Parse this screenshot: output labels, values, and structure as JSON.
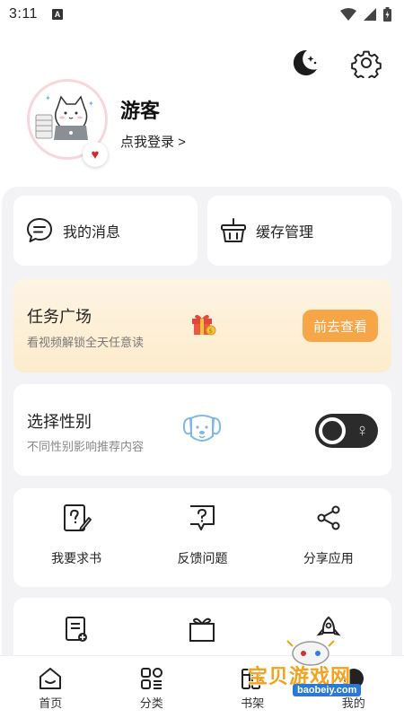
{
  "status_bar": {
    "time": "3:11",
    "badge": "A"
  },
  "header": {
    "theme_icon": "moon-stars-icon",
    "settings_icon": "gear-icon"
  },
  "profile": {
    "username": "游客",
    "login_link": "点我登录 >",
    "heart_icon": "heart-icon"
  },
  "quick_actions": {
    "messages_label": "我的消息",
    "cache_label": "缓存管理"
  },
  "task": {
    "title": "任务广场",
    "subtitle": "看视频解锁全天任意读",
    "button": "前去查看",
    "accent": "#f6a647"
  },
  "gender": {
    "title": "选择性别",
    "subtitle": "不同性别影响推荐内容",
    "toggle_symbol": "♀"
  },
  "tools": [
    {
      "label": "我要求书",
      "icon": "edit-document-icon"
    },
    {
      "label": "反馈问题",
      "icon": "feedback-question-icon"
    },
    {
      "label": "分享应用",
      "icon": "share-icon"
    }
  ],
  "tools2": [
    {
      "icon": "note-add-icon"
    },
    {
      "icon": "gift-box-icon"
    },
    {
      "icon": "rocket-icon"
    }
  ],
  "tabbar": [
    {
      "label": "首页",
      "icon": "home-icon"
    },
    {
      "label": "分类",
      "icon": "category-icon"
    },
    {
      "label": "书架",
      "icon": "bookshelf-icon"
    },
    {
      "label": "我的",
      "icon": "profile-icon"
    }
  ],
  "watermark": {
    "text": "宝贝游戏网",
    "url": "baobeiy.com"
  }
}
